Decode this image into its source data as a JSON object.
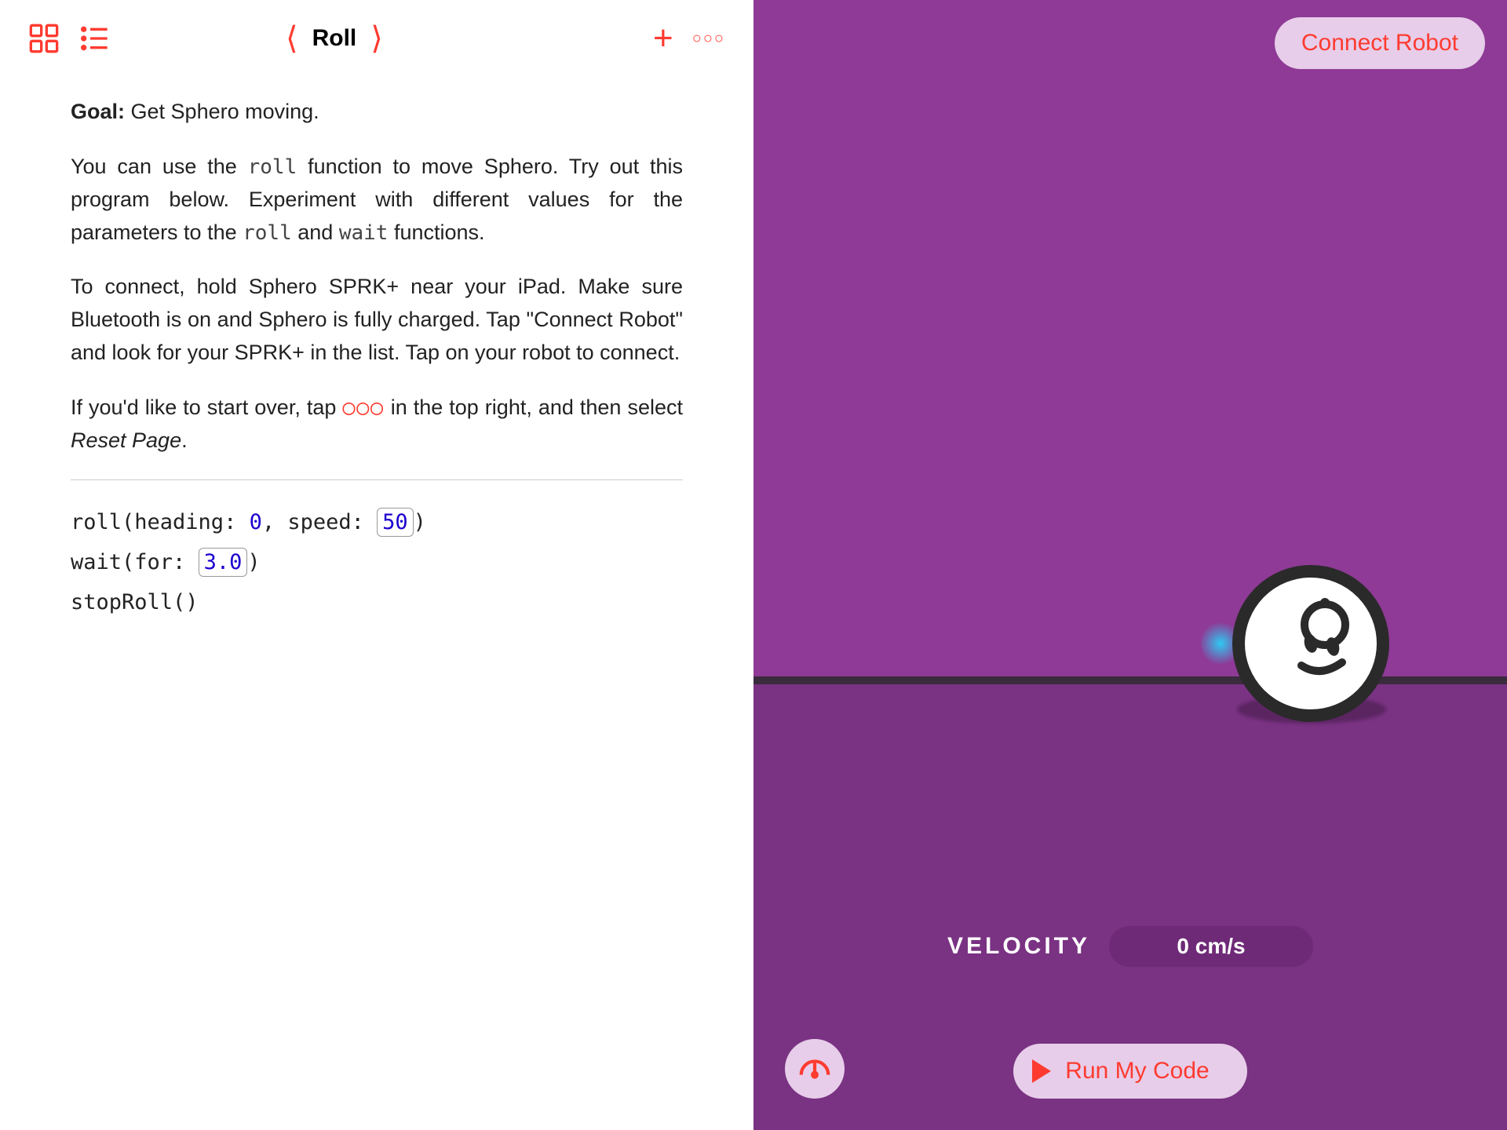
{
  "toolbar": {
    "title": "Roll"
  },
  "content": {
    "goal_label": "Goal:",
    "goal_text": " Get Sphero moving.",
    "para1_a": "You can use the ",
    "para1_code1": "roll",
    "para1_b": " function to move Sphero. Try out this program below. Experiment with different values for the parameters to the ",
    "para1_code2": "roll",
    "para1_c": " and ",
    "para1_code3": "wait",
    "para1_d": " functions.",
    "para2": "To connect, hold Sphero SPRK+ near your iPad. Make sure Bluetooth is on and Sphero is fully charged. Tap \"Connect Robot\" and look for your SPRK+ in the list. Tap on your robot to connect.",
    "para3_a": "If you'd like to start over, tap ",
    "para3_ooo": "○○○",
    "para3_b": " in the top right, and then select ",
    "para3_italic": "Reset Page",
    "para3_c": "."
  },
  "code": {
    "line1_a": "roll(heading: ",
    "line1_heading": "0",
    "line1_b": ", speed: ",
    "line1_speed": "50",
    "line1_c": ")",
    "line2_a": "wait(for: ",
    "line2_val": "3.0",
    "line2_b": ")",
    "line3": "stopRoll()"
  },
  "right": {
    "connect_label": "Connect Robot",
    "velocity_label": "VELOCITY",
    "velocity_value": "0 cm/s",
    "run_label": "Run My Code"
  }
}
